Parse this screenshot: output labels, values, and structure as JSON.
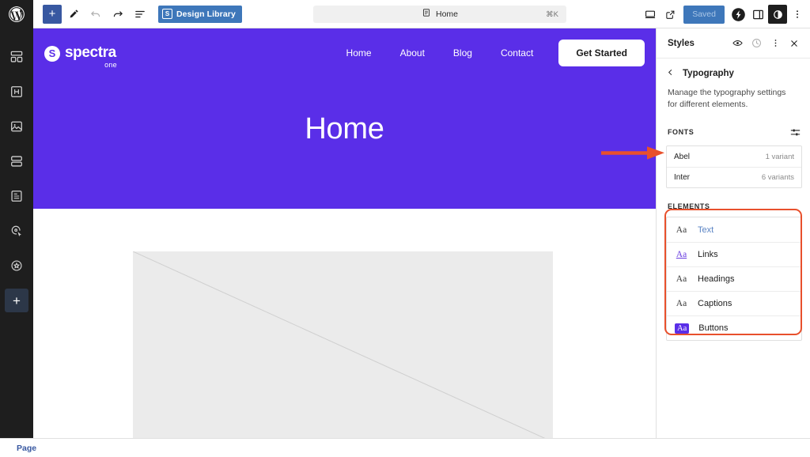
{
  "app": {
    "name": "WordPress Site Editor"
  },
  "rail": {
    "logo_icon": "wordpress-logo-icon",
    "items": [
      {
        "icon": "blocks-icon",
        "label": "Blocks"
      },
      {
        "icon": "heading-patterns-icon",
        "label": "Patterns"
      },
      {
        "icon": "media-image-icon",
        "label": "Media"
      },
      {
        "icon": "stacked-rows-icon",
        "label": "Templates"
      },
      {
        "icon": "document-icon",
        "label": "Pages"
      },
      {
        "icon": "cursor-target-icon",
        "label": "Interactions"
      },
      {
        "icon": "star-badge-icon",
        "label": "Favorites"
      }
    ],
    "add_label": "+"
  },
  "toolbar": {
    "add_block_label": "+",
    "edit_icon": "pencil-icon",
    "undo_icon": "undo-icon",
    "redo_icon": "redo-icon",
    "list_view_icon": "document-outline-icon",
    "design_library": {
      "badge": "S",
      "label": "Design Library"
    },
    "command_bar": {
      "icon": "page-icon",
      "value": "Home",
      "shortcut": "⌘K"
    },
    "right": {
      "preview_icon": "desktop-preview-icon",
      "view_site_icon": "external-link-icon",
      "save_label": "Saved",
      "spectra_icon": "spectra-bolt-icon",
      "sidebar_toggle_icon": "sidebar-toggle-icon",
      "styles_icon": "styles-contrast-icon",
      "options_icon": "three-dots-vertical-icon"
    }
  },
  "canvas": {
    "site": {
      "hero_bg": "#5a2ee8",
      "logo": {
        "mark": "S",
        "name": "spectra",
        "subtitle": "one"
      },
      "nav": [
        {
          "label": "Home"
        },
        {
          "label": "About"
        },
        {
          "label": "Blog"
        },
        {
          "label": "Contact"
        }
      ],
      "cta_label": "Get Started",
      "hero_title": "Home",
      "placeholder_alt": "image-placeholder"
    }
  },
  "sidebar": {
    "title": "Styles",
    "header_icons": {
      "preview_icon": "eye-icon",
      "revisions_icon": "history-clock-icon",
      "more_icon": "three-dots-vertical-icon",
      "close_icon": "close-x-icon"
    },
    "breadcrumb": {
      "back_icon": "chevron-left-icon",
      "label": "Typography"
    },
    "description": "Manage the typography settings for different elements.",
    "fonts_section": {
      "label": "Fonts",
      "manage_icon": "sliders-icon",
      "items": [
        {
          "name": "Abel",
          "variants": "1 variant"
        },
        {
          "name": "Inter",
          "variants": "6 variants"
        }
      ]
    },
    "elements_section": {
      "label": "Elements",
      "items": [
        {
          "sample": "Aa",
          "label": "Text",
          "style": "text"
        },
        {
          "sample": "Aa",
          "label": "Links",
          "style": "link"
        },
        {
          "sample": "Aa",
          "label": "Headings",
          "style": "heading"
        },
        {
          "sample": "Aa",
          "label": "Captions",
          "style": "caption"
        },
        {
          "sample": "Aa",
          "label": "Buttons",
          "style": "button"
        }
      ]
    }
  },
  "annotations": {
    "highlight_color": "#e8502c",
    "arrow_target": "Abel",
    "box_target": "Elements list"
  },
  "statusbar": {
    "label": "Page"
  }
}
